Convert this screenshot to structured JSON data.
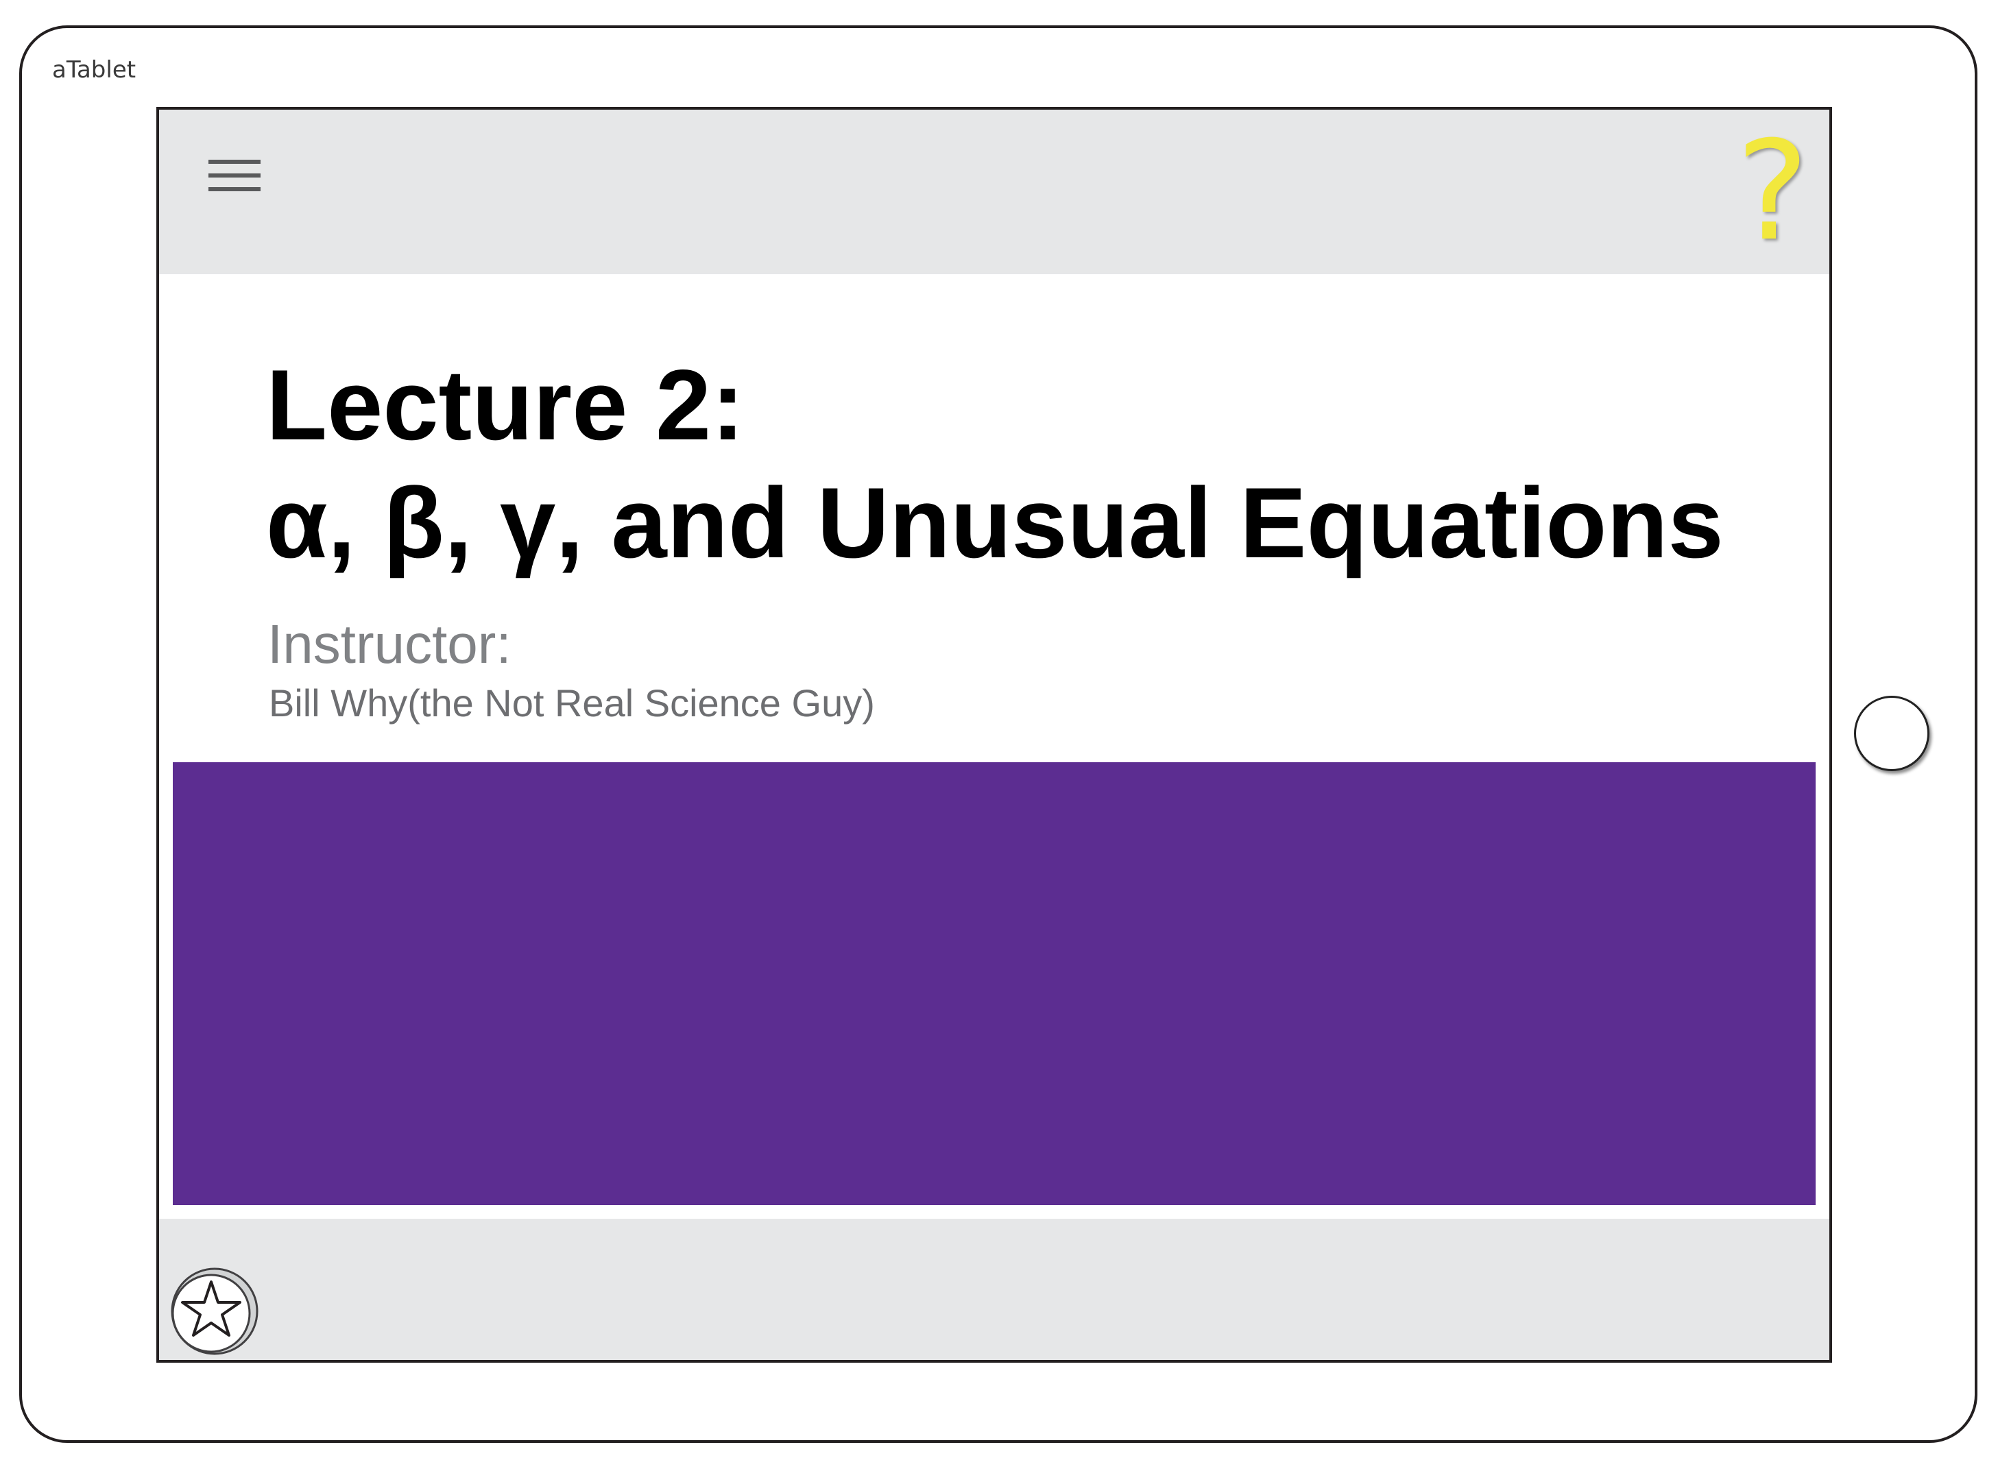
{
  "device": {
    "label": "aTablet"
  },
  "toolbar": {
    "menu_icon": "hamburger-menu-icon",
    "help_glyph": "?",
    "help_color": "#f2e83d"
  },
  "lecture": {
    "title_line1": "Lecture 2:",
    "title_line2": "α, β, γ, and Unusual Equations",
    "instructor_label": "Instructor:",
    "instructor_name": "Bill Why(the Not Real Science Guy)"
  },
  "media": {
    "color": "#5c2d91"
  },
  "footer": {
    "badge_icon": "star-badge-icon"
  }
}
